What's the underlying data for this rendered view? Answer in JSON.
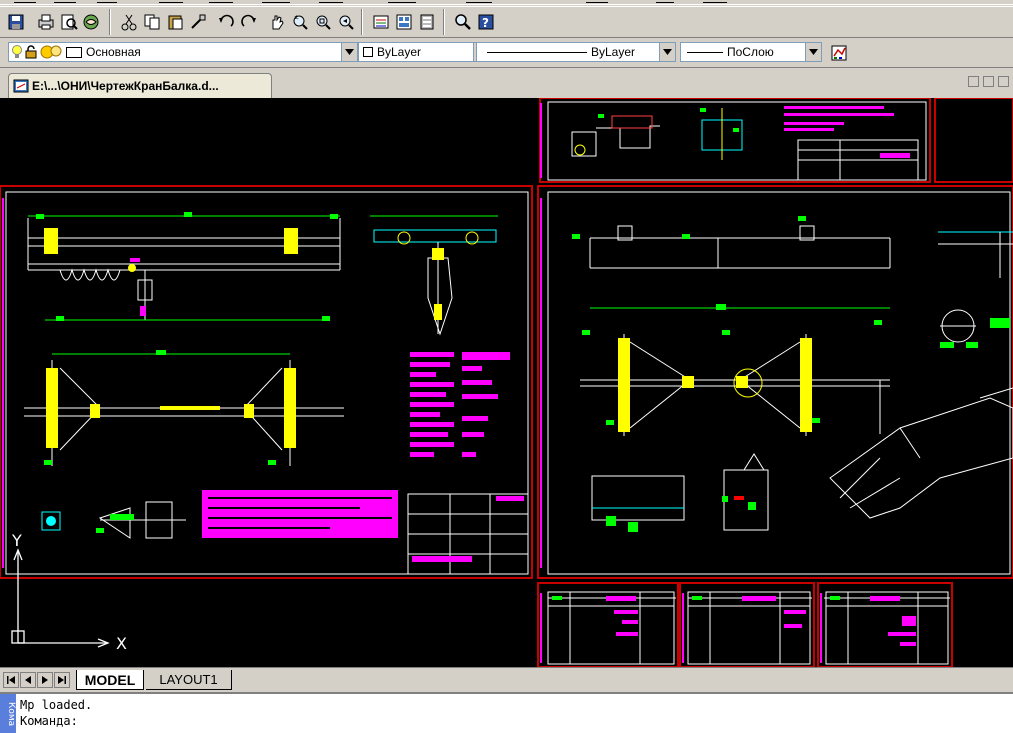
{
  "window": {
    "document_tab": "E:\\...\\ОНИ\\ЧертежКранБалка.d...",
    "layout_tabs": [
      {
        "label": "MODEL",
        "active": true
      },
      {
        "label": "LAYOUT1",
        "active": false
      }
    ]
  },
  "toolbar": {
    "icons": [
      "save-icon",
      "print-icon",
      "print-preview-icon",
      "publish-icon",
      "cut-icon",
      "copy-icon",
      "paste-icon",
      "match-properties-icon",
      "undo-icon",
      "redo-icon",
      "pan-icon",
      "zoom-realtime-icon",
      "zoom-window-icon",
      "zoom-previous-icon",
      "properties-icon",
      "design-center-icon",
      "tool-palettes-icon",
      "find-icon",
      "help-icon"
    ]
  },
  "properties_bar": {
    "layer": {
      "value": "Основная",
      "icons": [
        "bulb-icon",
        "lock-icon",
        "sun-icon",
        "color-box-icon"
      ]
    },
    "color": {
      "value": "ByLayer"
    },
    "linetype": {
      "value": "ByLayer"
    },
    "lineweight": {
      "value": "ПоСлою"
    }
  },
  "ucs": {
    "y_label": "Y",
    "x_label": "X"
  },
  "command": {
    "lines": [
      "Mp loaded.",
      "Команда:"
    ],
    "handle_label": "Кома"
  },
  "colors": {
    "canvas": "#000000",
    "drawing_white": "#ffffff",
    "frame_red": "#c80000",
    "magenta": "#ff00ff",
    "green": "#00ff00",
    "yellow": "#ffff00",
    "cyan": "#00ffff",
    "lineweight_red": "#800000"
  }
}
